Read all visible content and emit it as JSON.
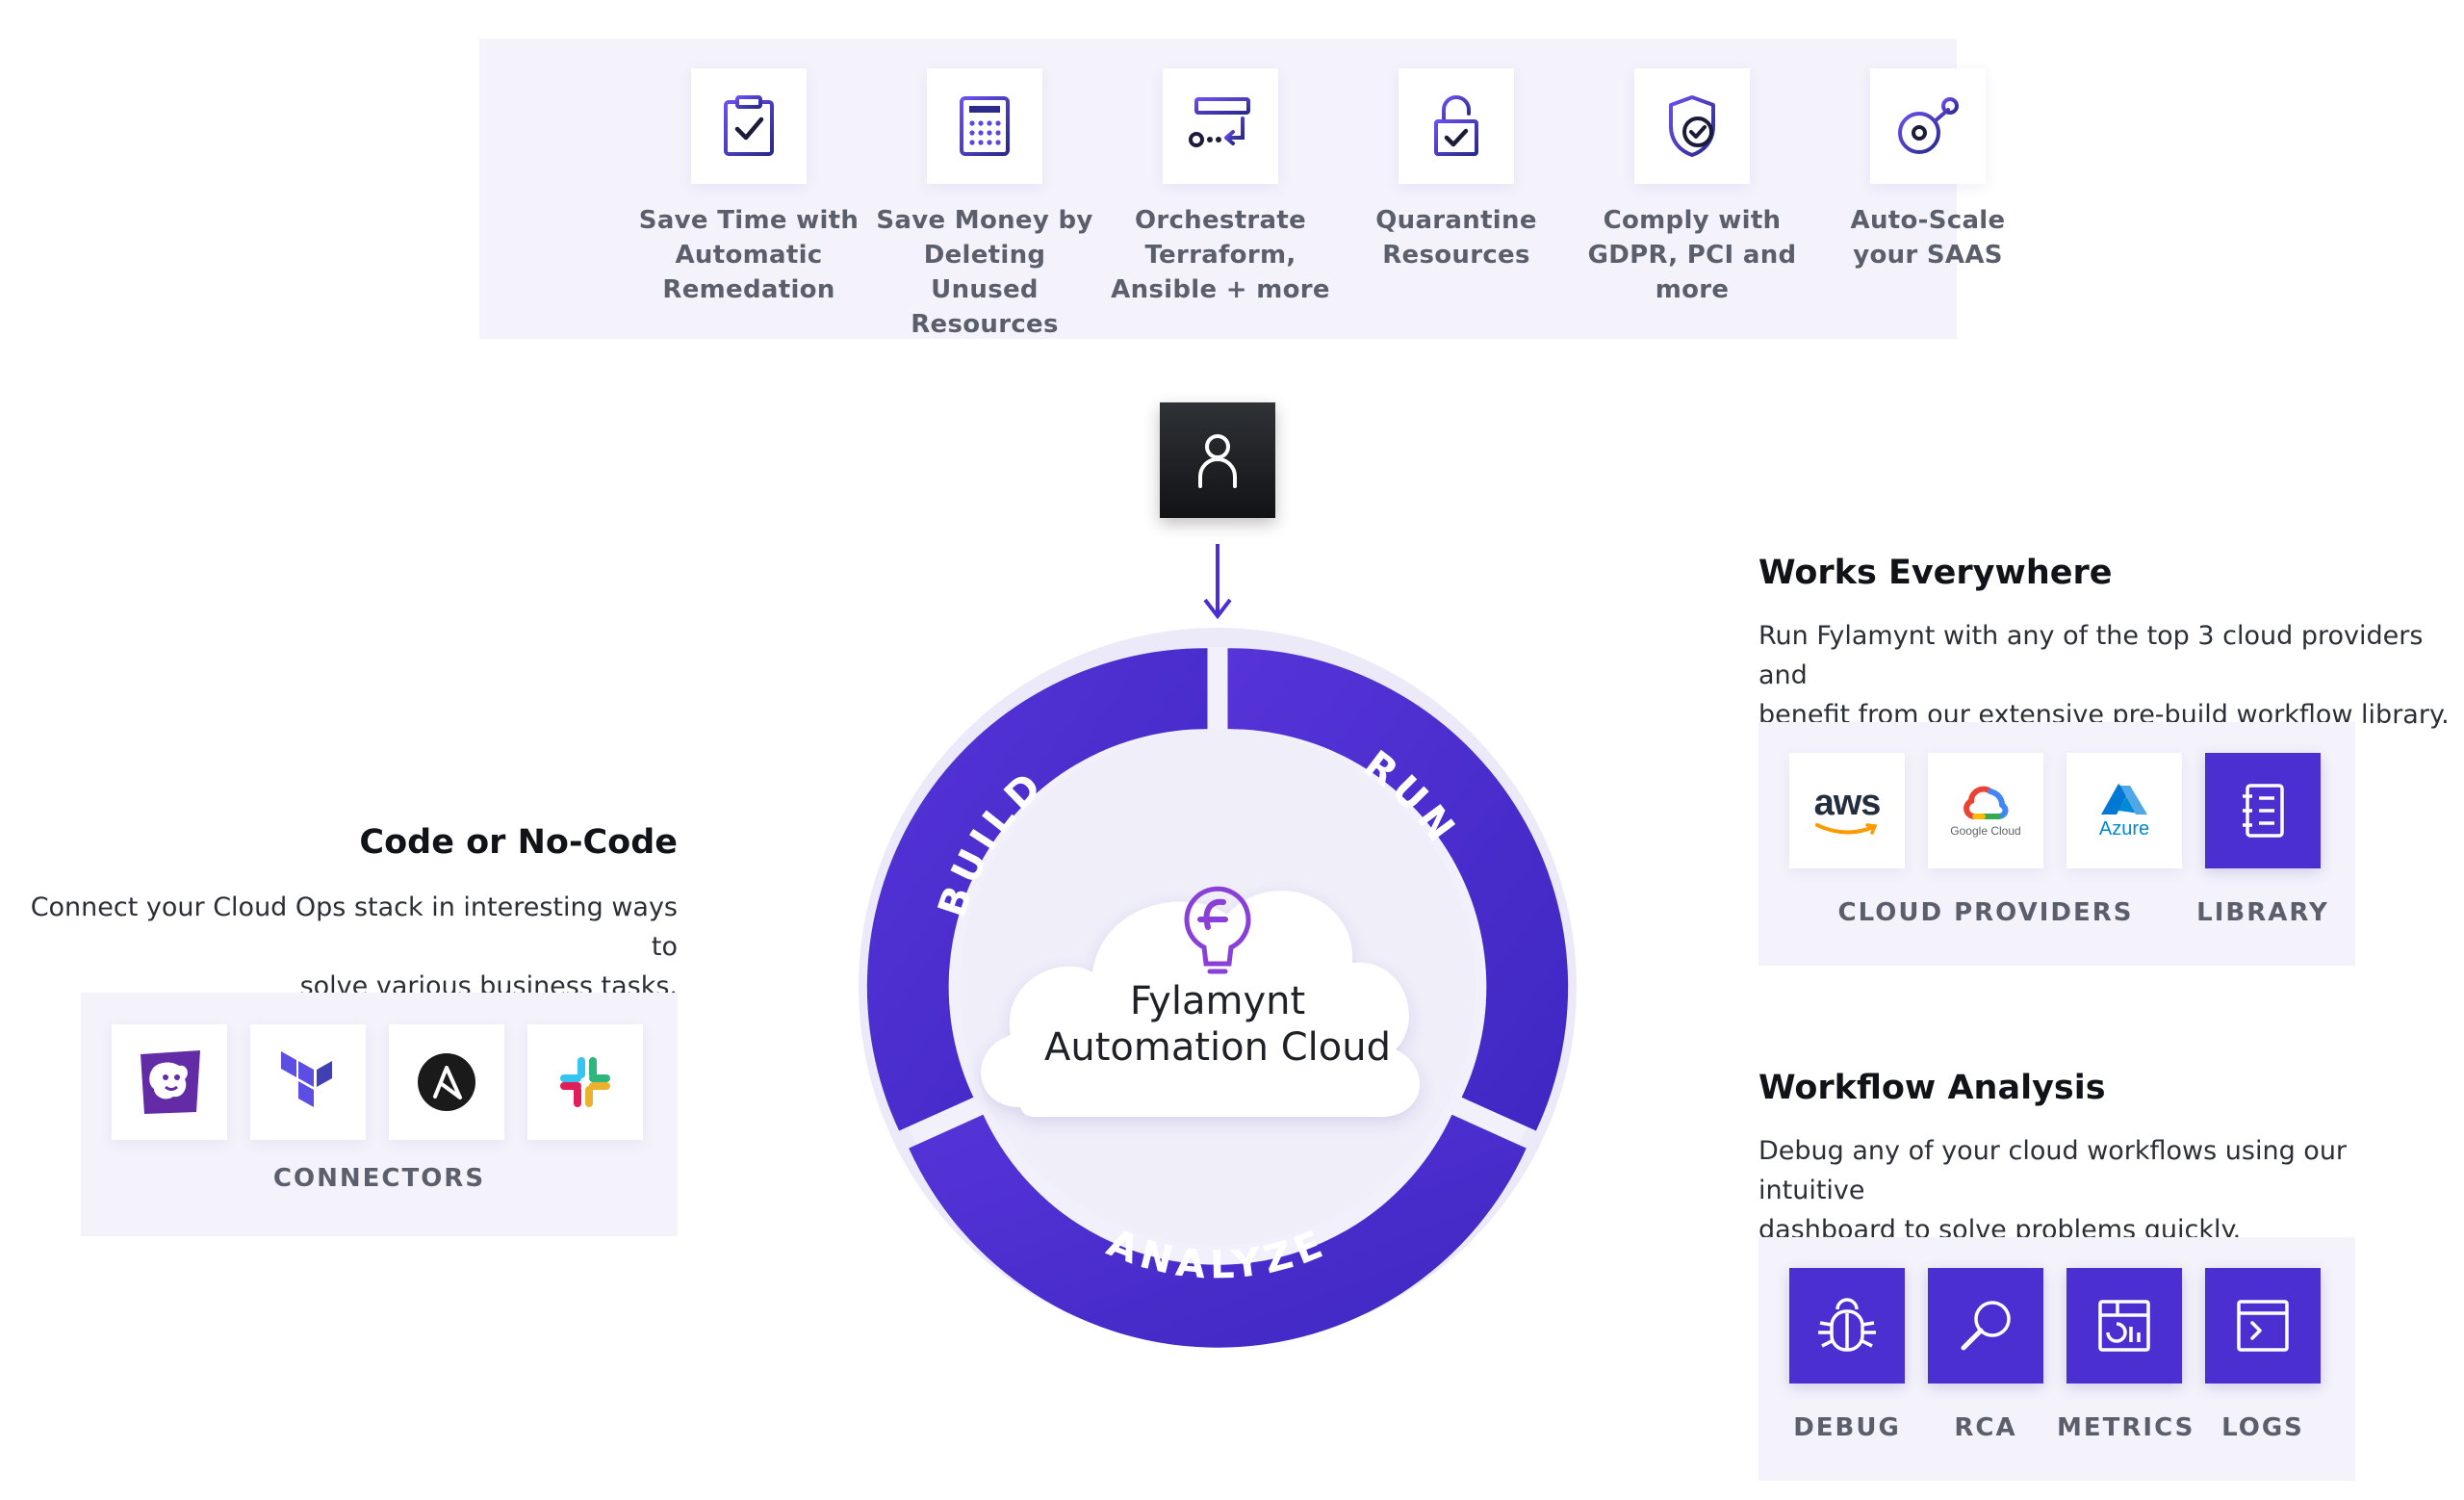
{
  "benefits": [
    {
      "icon": "clipboard-check-icon",
      "label": "Save Time with Automatic Remedation"
    },
    {
      "icon": "calculator-icon",
      "label": "Save Money by Deleting Unused Resources"
    },
    {
      "icon": "orchestrate-icon",
      "label": "Orchestrate Terraform, Ansible + more"
    },
    {
      "icon": "unlock-check-icon",
      "label": "Quarantine Resources"
    },
    {
      "icon": "shield-check-icon",
      "label": "Comply with GDPR, PCI and more"
    },
    {
      "icon": "autoscale-icon",
      "label": "Auto-Scale your SAAS"
    }
  ],
  "wheel": {
    "segments": [
      "BUILD",
      "RUN",
      "ANALYZE"
    ],
    "cloud_title_line1": "Fylamynt",
    "cloud_title_line2": "Automation Cloud"
  },
  "left": {
    "title": "Code or No-Code",
    "desc_line1": "Connect your Cloud Ops stack in interesting ways to",
    "desc_line2": "solve various business tasks.",
    "caption": "CONNECTORS",
    "connectors": [
      "datadog-logo",
      "terraform-logo",
      "ansible-logo",
      "slack-logo"
    ]
  },
  "works": {
    "title": "Works Everywhere",
    "desc_line1": "Run Fylamynt with any of the top 3 cloud providers and",
    "desc_line2": "benefit from our extensive pre-build workflow library.",
    "aws_label": "aws",
    "google_label": "Google Cloud",
    "azure_label": "Azure",
    "providers_caption": "CLOUD PROVIDERS",
    "library_caption": "LIBRARY"
  },
  "analysis": {
    "title": "Workflow Analysis",
    "desc_line1": "Debug any of your cloud workflows using our intuitive",
    "desc_line2": "dashboard to solve problems quickly.",
    "tools": [
      {
        "icon": "bug-icon",
        "label": "DEBUG"
      },
      {
        "icon": "magnifier-icon",
        "label": "RCA"
      },
      {
        "icon": "metrics-icon",
        "label": "METRICS"
      },
      {
        "icon": "terminal-icon",
        "label": "LOGS"
      }
    ]
  },
  "colors": {
    "brand": "#4b2fd1",
    "panel": "#f4f3fb",
    "ring": "#eae8f8",
    "caption": "#5b5f6b"
  }
}
